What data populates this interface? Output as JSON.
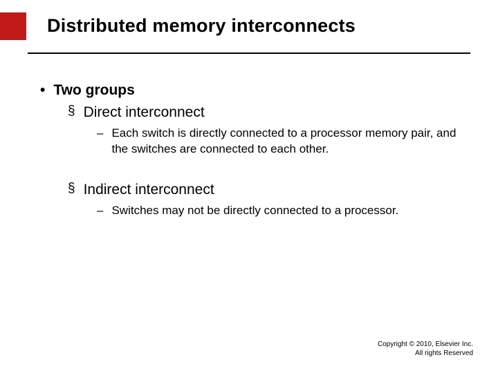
{
  "title": "Distributed memory interconnects",
  "bullets": {
    "lvl1": "Two groups",
    "lvl2a": "Direct interconnect",
    "lvl3a": "Each switch is directly connected to a processor memory pair, and the switches are connected to each other.",
    "lvl2b": "Indirect interconnect",
    "lvl3b": "Switches may not be directly connected to a processor."
  },
  "symbols": {
    "dot": "•",
    "square": "§",
    "dash": "–"
  },
  "footer": {
    "line1": "Copyright © 2010, Elsevier Inc.",
    "line2": "All rights Reserved"
  }
}
